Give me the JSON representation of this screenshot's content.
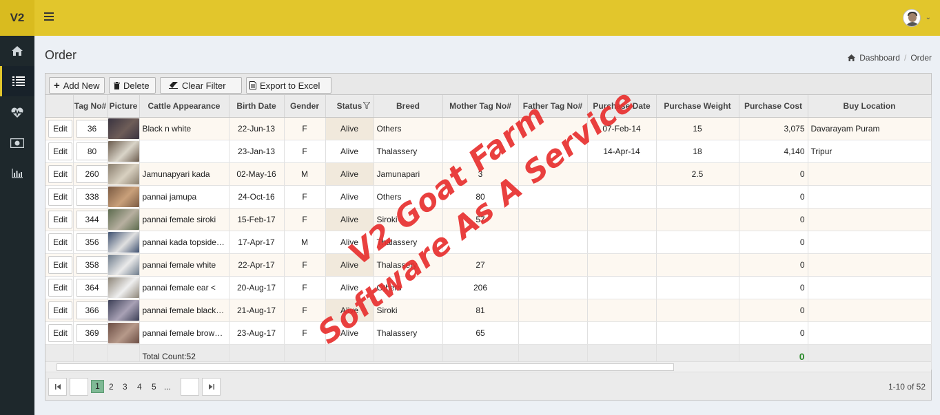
{
  "app": {
    "logo": "V2"
  },
  "colors": {
    "header": "#e2c62c",
    "sidebar": "#1e282c",
    "watermark": "#e8302f",
    "current_page": "#7fb995"
  },
  "sidebar": {
    "items": [
      "home-icon",
      "list-icon",
      "heartbeat-icon",
      "money-icon",
      "bar-chart-icon"
    ]
  },
  "page": {
    "title": "Order"
  },
  "breadcrumb": {
    "home": "Dashboard",
    "current": "Order"
  },
  "toolbar": {
    "add": "Add New",
    "delete": "Delete",
    "clear": "Clear Filter",
    "export": "Export to Excel"
  },
  "columns": [
    "",
    "Tag No#",
    "Picture",
    "Cattle Appearance",
    "Birth Date",
    "Gender",
    "Status",
    "Breed",
    "Mother Tag No#",
    "Father Tag No#",
    "Purchase Date",
    "Purchase Weight",
    "Purchase Cost",
    "Buy Location"
  ],
  "edit_label": "Edit",
  "rows": [
    {
      "tag": "36",
      "appearance": "Black n white",
      "birth": "22-Jun-13",
      "gender": "F",
      "status": "Alive",
      "breed": "Others",
      "mother": "",
      "father": "",
      "pdate": "07-Feb-14",
      "weight": "15",
      "cost": "3,075",
      "location": "Davarayam Puram"
    },
    {
      "tag": "80",
      "appearance": "",
      "birth": "23-Jan-13",
      "gender": "F",
      "status": "Alive",
      "breed": "Thalassery",
      "mother": "",
      "father": "",
      "pdate": "14-Apr-14",
      "weight": "18",
      "cost": "4,140",
      "location": "Tripur"
    },
    {
      "tag": "260",
      "appearance": "Jamunapyari kada",
      "birth": "02-May-16",
      "gender": "M",
      "status": "Alive",
      "breed": "Jamunapari",
      "mother": "3",
      "father": "",
      "pdate": "",
      "weight": "2.5",
      "cost": "0",
      "location": ""
    },
    {
      "tag": "338",
      "appearance": "pannai jamupa",
      "birth": "24-Oct-16",
      "gender": "F",
      "status": "Alive",
      "breed": "Others",
      "mother": "80",
      "father": "",
      "pdate": "",
      "weight": "",
      "cost": "0",
      "location": ""
    },
    {
      "tag": "344",
      "appearance": "pannai female siroki",
      "birth": "15-Feb-17",
      "gender": "F",
      "status": "Alive",
      "breed": "Siroki",
      "mother": "57",
      "father": "",
      "pdate": "",
      "weight": "",
      "cost": "0",
      "location": ""
    },
    {
      "tag": "356",
      "appearance": "pannai kada topside white",
      "birth": "17-Apr-17",
      "gender": "M",
      "status": "Alive",
      "breed": "Thalassery",
      "mother": "",
      "father": "",
      "pdate": "",
      "weight": "",
      "cost": "0",
      "location": ""
    },
    {
      "tag": "358",
      "appearance": "pannai female white",
      "birth": "22-Apr-17",
      "gender": "F",
      "status": "Alive",
      "breed": "Thalassery",
      "mother": "27",
      "father": "",
      "pdate": "",
      "weight": "",
      "cost": "0",
      "location": ""
    },
    {
      "tag": "364",
      "appearance": "pannai female ear &lt; ",
      "birth": "20-Aug-17",
      "gender": "F",
      "status": "Alive",
      "breed": "Others",
      "mother": "206",
      "father": "",
      "pdate": "",
      "weight": "",
      "cost": "0",
      "location": ""
    },
    {
      "tag": "366",
      "appearance": "pannai female black side",
      "birth": "21-Aug-17",
      "gender": "F",
      "status": "Alive",
      "breed": "Siroki",
      "mother": "81",
      "father": "",
      "pdate": "",
      "weight": "",
      "cost": "0",
      "location": ""
    },
    {
      "tag": "369",
      "appearance": "pannai female brown white",
      "birth": "23-Aug-17",
      "gender": "F",
      "status": "Alive",
      "breed": "Thalassery",
      "mother": "65",
      "father": "",
      "pdate": "",
      "weight": "",
      "cost": "0",
      "location": ""
    }
  ],
  "footer": {
    "total_count": "Total Count:52",
    "total_cost": "0"
  },
  "pager": {
    "pages": [
      "1",
      "2",
      "3",
      "4",
      "5",
      "..."
    ],
    "current": "1",
    "info": "1-10 of 52"
  },
  "watermark": {
    "line1": "V2 Goat Farm",
    "line2": "Software As A Service"
  }
}
